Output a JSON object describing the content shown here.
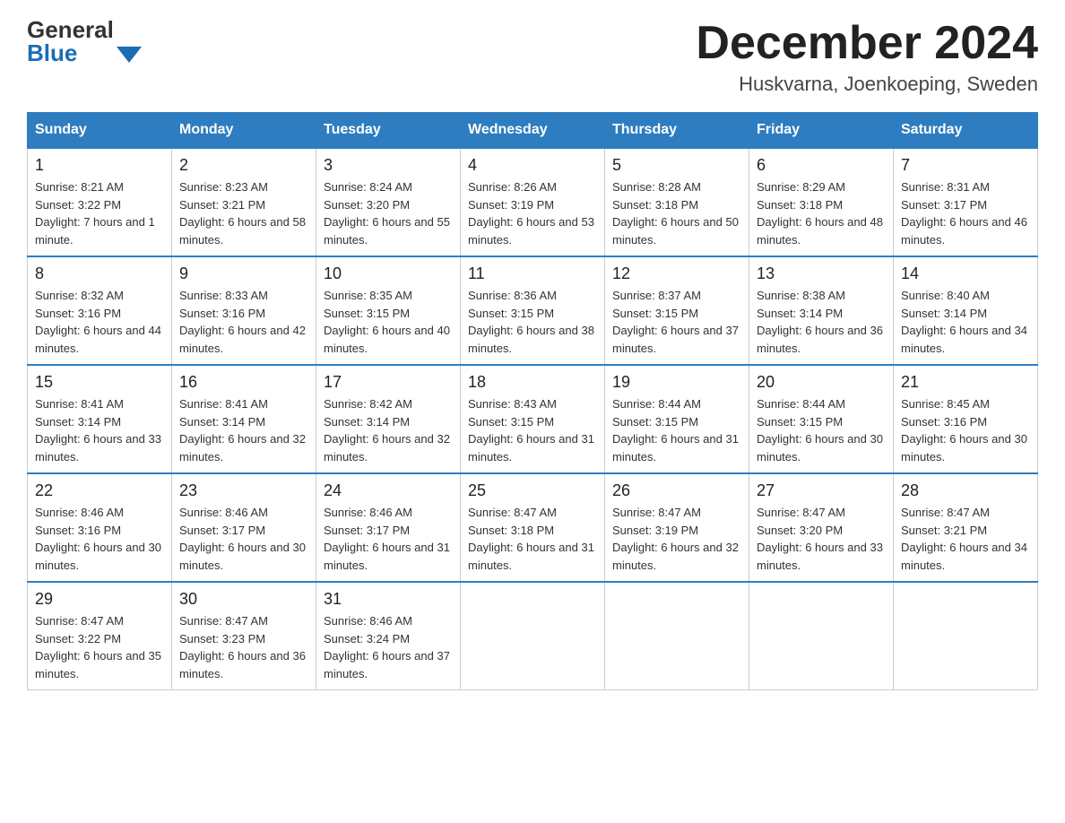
{
  "header": {
    "logo": {
      "general": "General",
      "blue": "Blue",
      "arrow_label": "blue-arrow-icon"
    },
    "title": "December 2024",
    "subtitle": "Huskvarna, Joenkoeping, Sweden"
  },
  "calendar": {
    "days_of_week": [
      "Sunday",
      "Monday",
      "Tuesday",
      "Wednesday",
      "Thursday",
      "Friday",
      "Saturday"
    ],
    "weeks": [
      [
        {
          "day": "1",
          "sunrise": "8:21 AM",
          "sunset": "3:22 PM",
          "daylight": "7 hours and 1 minute."
        },
        {
          "day": "2",
          "sunrise": "8:23 AM",
          "sunset": "3:21 PM",
          "daylight": "6 hours and 58 minutes."
        },
        {
          "day": "3",
          "sunrise": "8:24 AM",
          "sunset": "3:20 PM",
          "daylight": "6 hours and 55 minutes."
        },
        {
          "day": "4",
          "sunrise": "8:26 AM",
          "sunset": "3:19 PM",
          "daylight": "6 hours and 53 minutes."
        },
        {
          "day": "5",
          "sunrise": "8:28 AM",
          "sunset": "3:18 PM",
          "daylight": "6 hours and 50 minutes."
        },
        {
          "day": "6",
          "sunrise": "8:29 AM",
          "sunset": "3:18 PM",
          "daylight": "6 hours and 48 minutes."
        },
        {
          "day": "7",
          "sunrise": "8:31 AM",
          "sunset": "3:17 PM",
          "daylight": "6 hours and 46 minutes."
        }
      ],
      [
        {
          "day": "8",
          "sunrise": "8:32 AM",
          "sunset": "3:16 PM",
          "daylight": "6 hours and 44 minutes."
        },
        {
          "day": "9",
          "sunrise": "8:33 AM",
          "sunset": "3:16 PM",
          "daylight": "6 hours and 42 minutes."
        },
        {
          "day": "10",
          "sunrise": "8:35 AM",
          "sunset": "3:15 PM",
          "daylight": "6 hours and 40 minutes."
        },
        {
          "day": "11",
          "sunrise": "8:36 AM",
          "sunset": "3:15 PM",
          "daylight": "6 hours and 38 minutes."
        },
        {
          "day": "12",
          "sunrise": "8:37 AM",
          "sunset": "3:15 PM",
          "daylight": "6 hours and 37 minutes."
        },
        {
          "day": "13",
          "sunrise": "8:38 AM",
          "sunset": "3:14 PM",
          "daylight": "6 hours and 36 minutes."
        },
        {
          "day": "14",
          "sunrise": "8:40 AM",
          "sunset": "3:14 PM",
          "daylight": "6 hours and 34 minutes."
        }
      ],
      [
        {
          "day": "15",
          "sunrise": "8:41 AM",
          "sunset": "3:14 PM",
          "daylight": "6 hours and 33 minutes."
        },
        {
          "day": "16",
          "sunrise": "8:41 AM",
          "sunset": "3:14 PM",
          "daylight": "6 hours and 32 minutes."
        },
        {
          "day": "17",
          "sunrise": "8:42 AM",
          "sunset": "3:14 PM",
          "daylight": "6 hours and 32 minutes."
        },
        {
          "day": "18",
          "sunrise": "8:43 AM",
          "sunset": "3:15 PM",
          "daylight": "6 hours and 31 minutes."
        },
        {
          "day": "19",
          "sunrise": "8:44 AM",
          "sunset": "3:15 PM",
          "daylight": "6 hours and 31 minutes."
        },
        {
          "day": "20",
          "sunrise": "8:44 AM",
          "sunset": "3:15 PM",
          "daylight": "6 hours and 30 minutes."
        },
        {
          "day": "21",
          "sunrise": "8:45 AM",
          "sunset": "3:16 PM",
          "daylight": "6 hours and 30 minutes."
        }
      ],
      [
        {
          "day": "22",
          "sunrise": "8:46 AM",
          "sunset": "3:16 PM",
          "daylight": "6 hours and 30 minutes."
        },
        {
          "day": "23",
          "sunrise": "8:46 AM",
          "sunset": "3:17 PM",
          "daylight": "6 hours and 30 minutes."
        },
        {
          "day": "24",
          "sunrise": "8:46 AM",
          "sunset": "3:17 PM",
          "daylight": "6 hours and 31 minutes."
        },
        {
          "day": "25",
          "sunrise": "8:47 AM",
          "sunset": "3:18 PM",
          "daylight": "6 hours and 31 minutes."
        },
        {
          "day": "26",
          "sunrise": "8:47 AM",
          "sunset": "3:19 PM",
          "daylight": "6 hours and 32 minutes."
        },
        {
          "day": "27",
          "sunrise": "8:47 AM",
          "sunset": "3:20 PM",
          "daylight": "6 hours and 33 minutes."
        },
        {
          "day": "28",
          "sunrise": "8:47 AM",
          "sunset": "3:21 PM",
          "daylight": "6 hours and 34 minutes."
        }
      ],
      [
        {
          "day": "29",
          "sunrise": "8:47 AM",
          "sunset": "3:22 PM",
          "daylight": "6 hours and 35 minutes."
        },
        {
          "day": "30",
          "sunrise": "8:47 AM",
          "sunset": "3:23 PM",
          "daylight": "6 hours and 36 minutes."
        },
        {
          "day": "31",
          "sunrise": "8:46 AM",
          "sunset": "3:24 PM",
          "daylight": "6 hours and 37 minutes."
        },
        null,
        null,
        null,
        null
      ]
    ],
    "labels": {
      "sunrise": "Sunrise:",
      "sunset": "Sunset:",
      "daylight": "Daylight:"
    }
  }
}
